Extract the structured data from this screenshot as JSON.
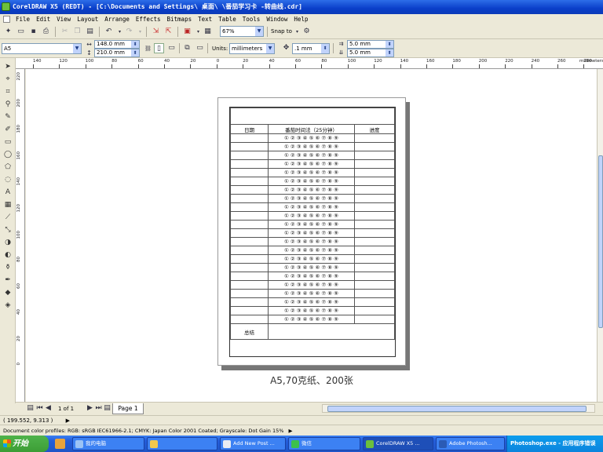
{
  "window": {
    "title": "CorelDRAW X5 (REDT) - [C:\\Documents and Settings\\   桌面\\   \\番茄学习卡 -转曲线.cdr]"
  },
  "menu": [
    "File",
    "Edit",
    "View",
    "Layout",
    "Arrange",
    "Effects",
    "Bitmaps",
    "Text",
    "Table",
    "Tools",
    "Window",
    "Help"
  ],
  "toolbar1": {
    "zoom": "67%",
    "snap": "Snap to"
  },
  "toolbar2": {
    "page_size": "A5",
    "width": "148.0 mm",
    "height": "210.0 mm",
    "units_label": "Units:",
    "units": "millimeters",
    "nudge": ".1 mm",
    "dup_x": "5.0 mm",
    "dup_y": "5.0 mm"
  },
  "hruler": {
    "unit": "millimeters",
    "ticks": [
      "140",
      "120",
      "100",
      "80",
      "60",
      "40",
      "20",
      "0",
      "20",
      "40",
      "60",
      "80",
      "100",
      "120",
      "140",
      "160",
      "180",
      "200",
      "220",
      "240",
      "260",
      "280"
    ]
  },
  "vruler": {
    "ticks": [
      "220",
      "200",
      "180",
      "160",
      "140",
      "120",
      "100",
      "80",
      "60",
      "40",
      "20",
      "0"
    ]
  },
  "form": {
    "header": {
      "date": "日期",
      "method": "番茄时间法（25分钟）",
      "progress": "进度"
    },
    "circles": "① ② ③ ④ ⑤ ⑥ ⑦ ⑧ ⑨",
    "rows": 22,
    "footer": "总结"
  },
  "caption": "A5,70克纸、200张",
  "pagebar": {
    "page_count": "1 of 1",
    "tab": "Page 1"
  },
  "status": {
    "coords": "( 199.552, 9.313 )",
    "profiles": "Document color profiles: RGB: sRGB IEC61966-2.1; CMYK: Japan Color 2001 Coated; Grayscale: Dot Gain 15%"
  },
  "taskbar": {
    "start": "开始",
    "tasks": [
      "我的电脑",
      "",
      "Add New Post ...",
      "微信",
      "CorelDRAW X5 ...",
      "Adobe Photosh..."
    ],
    "tray": "Photoshop.exe - 应用程序错误"
  }
}
